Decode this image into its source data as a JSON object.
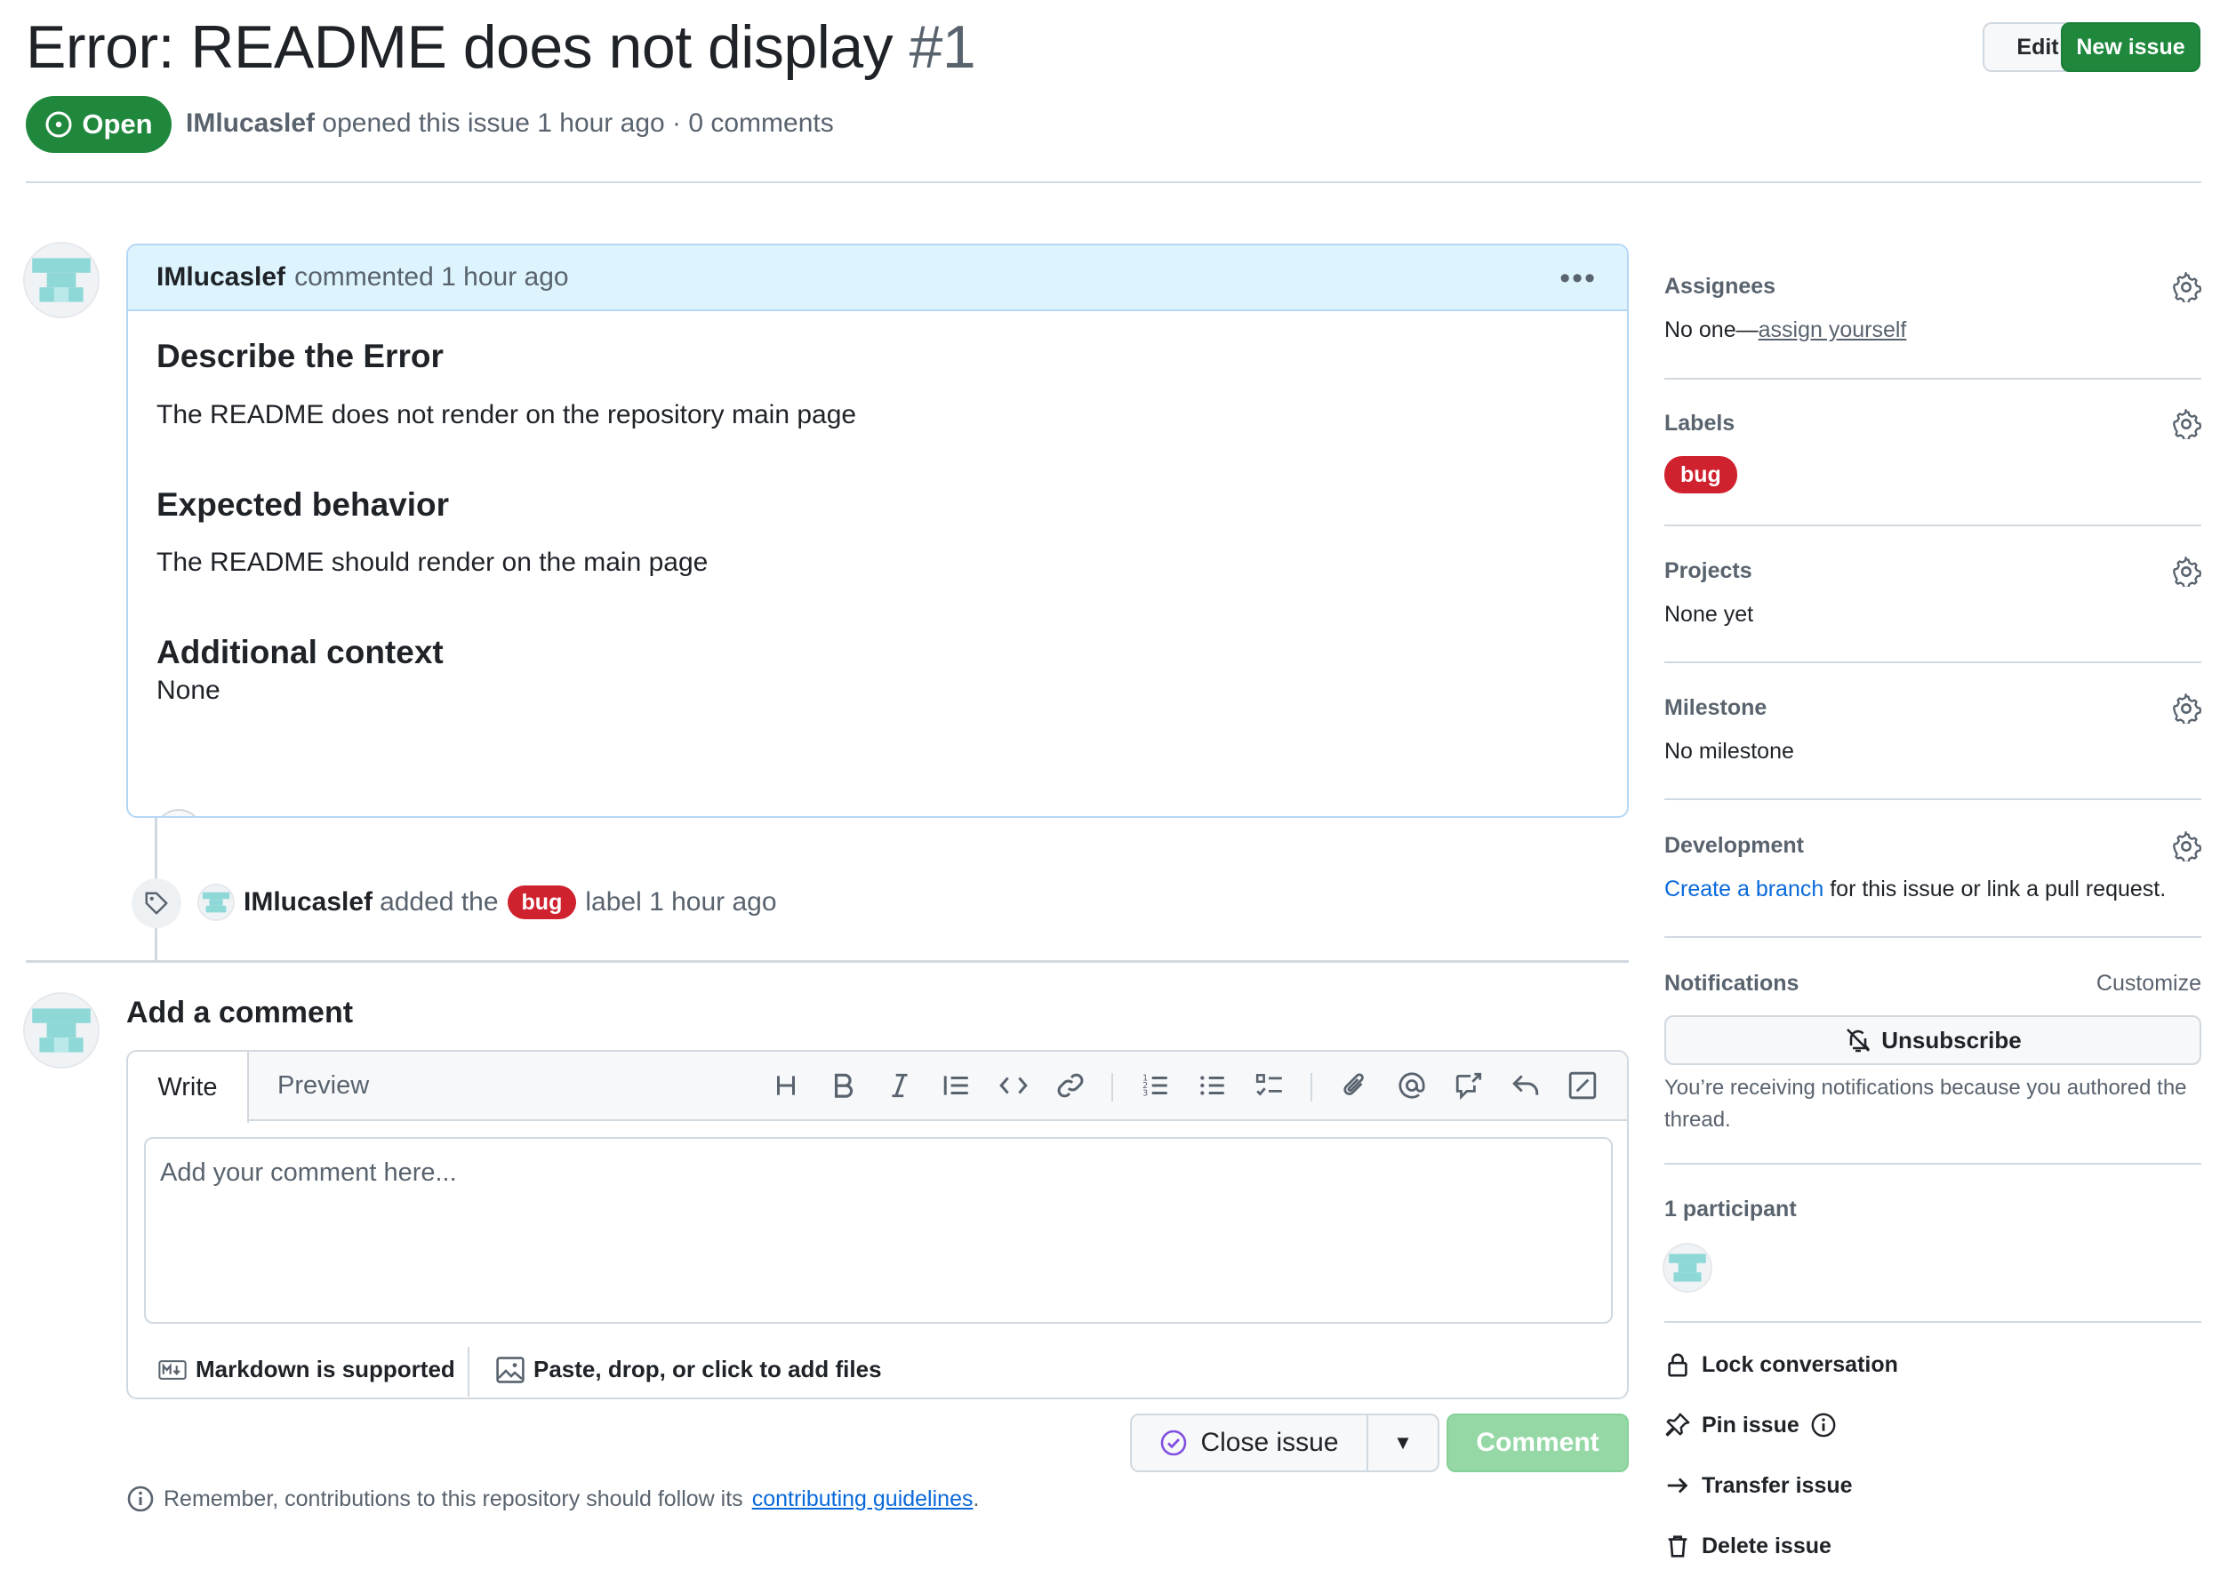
{
  "issue": {
    "title": "Error: README does not display",
    "number": "#1",
    "state": "Open",
    "author": "IMlucaslef",
    "opened_text": "opened this issue 1 hour ago · 0 comments"
  },
  "header_buttons": {
    "edit": "Edit",
    "new_issue": "New issue"
  },
  "comment": {
    "author": "IMlucaslef",
    "time": "commented 1 hour ago",
    "h_error": "Describe the Error",
    "p_error": "The README does not render on the repository main page",
    "h_expected": "Expected behavior",
    "p_expected": "The README should render on the main page",
    "h_context": "Additional context",
    "p_context": "None"
  },
  "event": {
    "actor": "IMlucaslef",
    "added": "added the",
    "label": "bug",
    "suffix": "label 1 hour ago"
  },
  "composer": {
    "title": "Add a comment",
    "tab_write": "Write",
    "tab_preview": "Preview",
    "placeholder": "Add your comment here...",
    "markdown": "Markdown is supported",
    "files": "Paste, drop, or click to add files",
    "close_issue": "Close issue",
    "comment": "Comment",
    "reminder_prefix": "Remember, contributions to this repository should follow its",
    "reminder_link": "contributing guidelines",
    "reminder_suffix": "."
  },
  "sidebar": {
    "assignees": "Assignees",
    "assignees_value": "No one—",
    "assign_yourself": "assign yourself",
    "labels": "Labels",
    "label_bug": "bug",
    "projects": "Projects",
    "projects_value": "None yet",
    "milestone": "Milestone",
    "milestone_value": "No milestone",
    "development": "Development",
    "dev_link": "Create a branch",
    "dev_text": "for this issue or link a pull request.",
    "notifications": "Notifications",
    "customize": "Customize",
    "unsubscribe": "Unsubscribe",
    "notif_text": "You’re receiving notifications because you authored the thread.",
    "participants": "1 participant",
    "lock": "Lock conversation",
    "pin": "Pin issue",
    "transfer": "Transfer issue",
    "delete": "Delete issue"
  },
  "colors": {
    "open_green": "#1f883d",
    "bug_red": "#cf222e",
    "link_blue": "#0969da",
    "header_blue": "#ddf4ff"
  }
}
